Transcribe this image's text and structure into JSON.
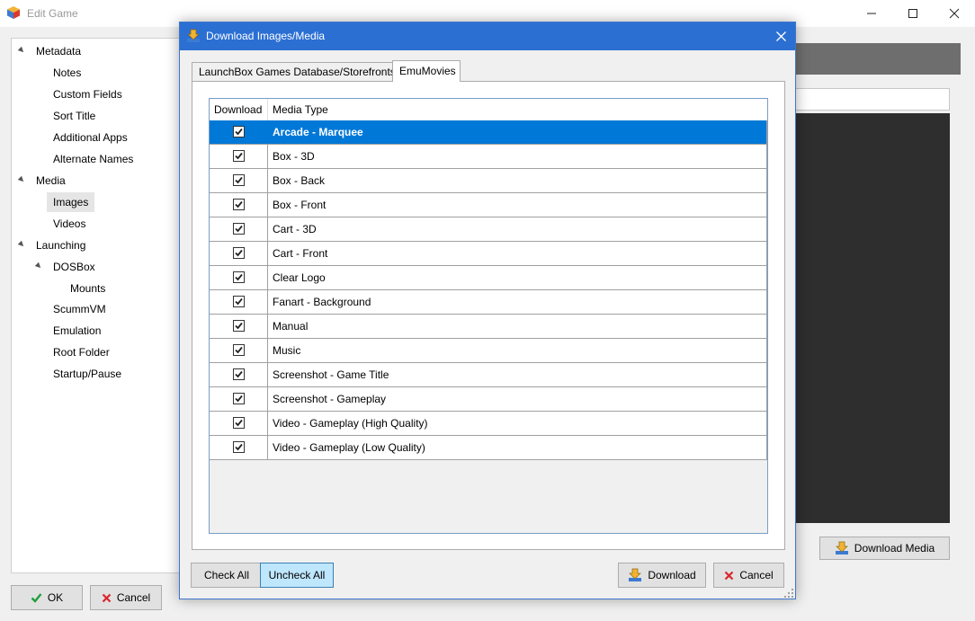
{
  "main_window": {
    "title": "Edit Game",
    "tree": [
      {
        "label": "Metadata",
        "level": 0,
        "expanded": true
      },
      {
        "label": "Notes",
        "level": 1
      },
      {
        "label": "Custom Fields",
        "level": 1
      },
      {
        "label": "Sort Title",
        "level": 1
      },
      {
        "label": "Additional Apps",
        "level": 1
      },
      {
        "label": "Alternate Names",
        "level": 1
      },
      {
        "label": "Media",
        "level": 0,
        "expanded": true
      },
      {
        "label": "Images",
        "level": 1,
        "selected": true
      },
      {
        "label": "Videos",
        "level": 1
      },
      {
        "label": "Launching",
        "level": 0,
        "expanded": true
      },
      {
        "label": "DOSBox",
        "level": 1,
        "expanded": true
      },
      {
        "label": "Mounts",
        "level": 2
      },
      {
        "label": "ScummVM",
        "level": 1
      },
      {
        "label": "Emulation",
        "level": 1
      },
      {
        "label": "Root Folder",
        "level": 1
      },
      {
        "label": "Startup/Pause",
        "level": 1
      }
    ],
    "ok_label": "OK",
    "cancel_label": "Cancel",
    "download_media_label": "Download Media"
  },
  "dialog": {
    "title": "Download Images/Media",
    "tabs": [
      {
        "label": "LaunchBox Games Database/Storefronts",
        "active": false
      },
      {
        "label": "EmuMovies",
        "active": true
      }
    ],
    "columns": {
      "download": "Download",
      "media_type": "Media Type"
    },
    "rows": [
      {
        "media_type": "Arcade - Marquee",
        "checked": true,
        "selected": true
      },
      {
        "media_type": "Box - 3D",
        "checked": true
      },
      {
        "media_type": "Box - Back",
        "checked": true
      },
      {
        "media_type": "Box - Front",
        "checked": true
      },
      {
        "media_type": "Cart - 3D",
        "checked": true
      },
      {
        "media_type": "Cart - Front",
        "checked": true
      },
      {
        "media_type": "Clear Logo",
        "checked": true
      },
      {
        "media_type": "Fanart - Background",
        "checked": true
      },
      {
        "media_type": "Manual",
        "checked": true
      },
      {
        "media_type": "Music",
        "checked": true
      },
      {
        "media_type": "Screenshot - Game Title",
        "checked": true
      },
      {
        "media_type": "Screenshot - Gameplay",
        "checked": true
      },
      {
        "media_type": "Video - Gameplay (High Quality)",
        "checked": true
      },
      {
        "media_type": "Video - Gameplay (Low Quality)",
        "checked": true
      }
    ],
    "check_all_label": "Check All",
    "uncheck_all_label": "Uncheck All",
    "download_label": "Download",
    "cancel_label": "Cancel"
  },
  "colors": {
    "dialog_titlebar": "#2b6fd3",
    "selection": "#0078d7",
    "button_hover": "#bee6fd",
    "ok_check": "#1f9e3a",
    "cancel_x": "#d9262c"
  },
  "icons": {
    "app": "launchbox-cube-icon",
    "download": "download-arrow-icon",
    "ok": "check-icon",
    "cancel": "x-icon"
  }
}
